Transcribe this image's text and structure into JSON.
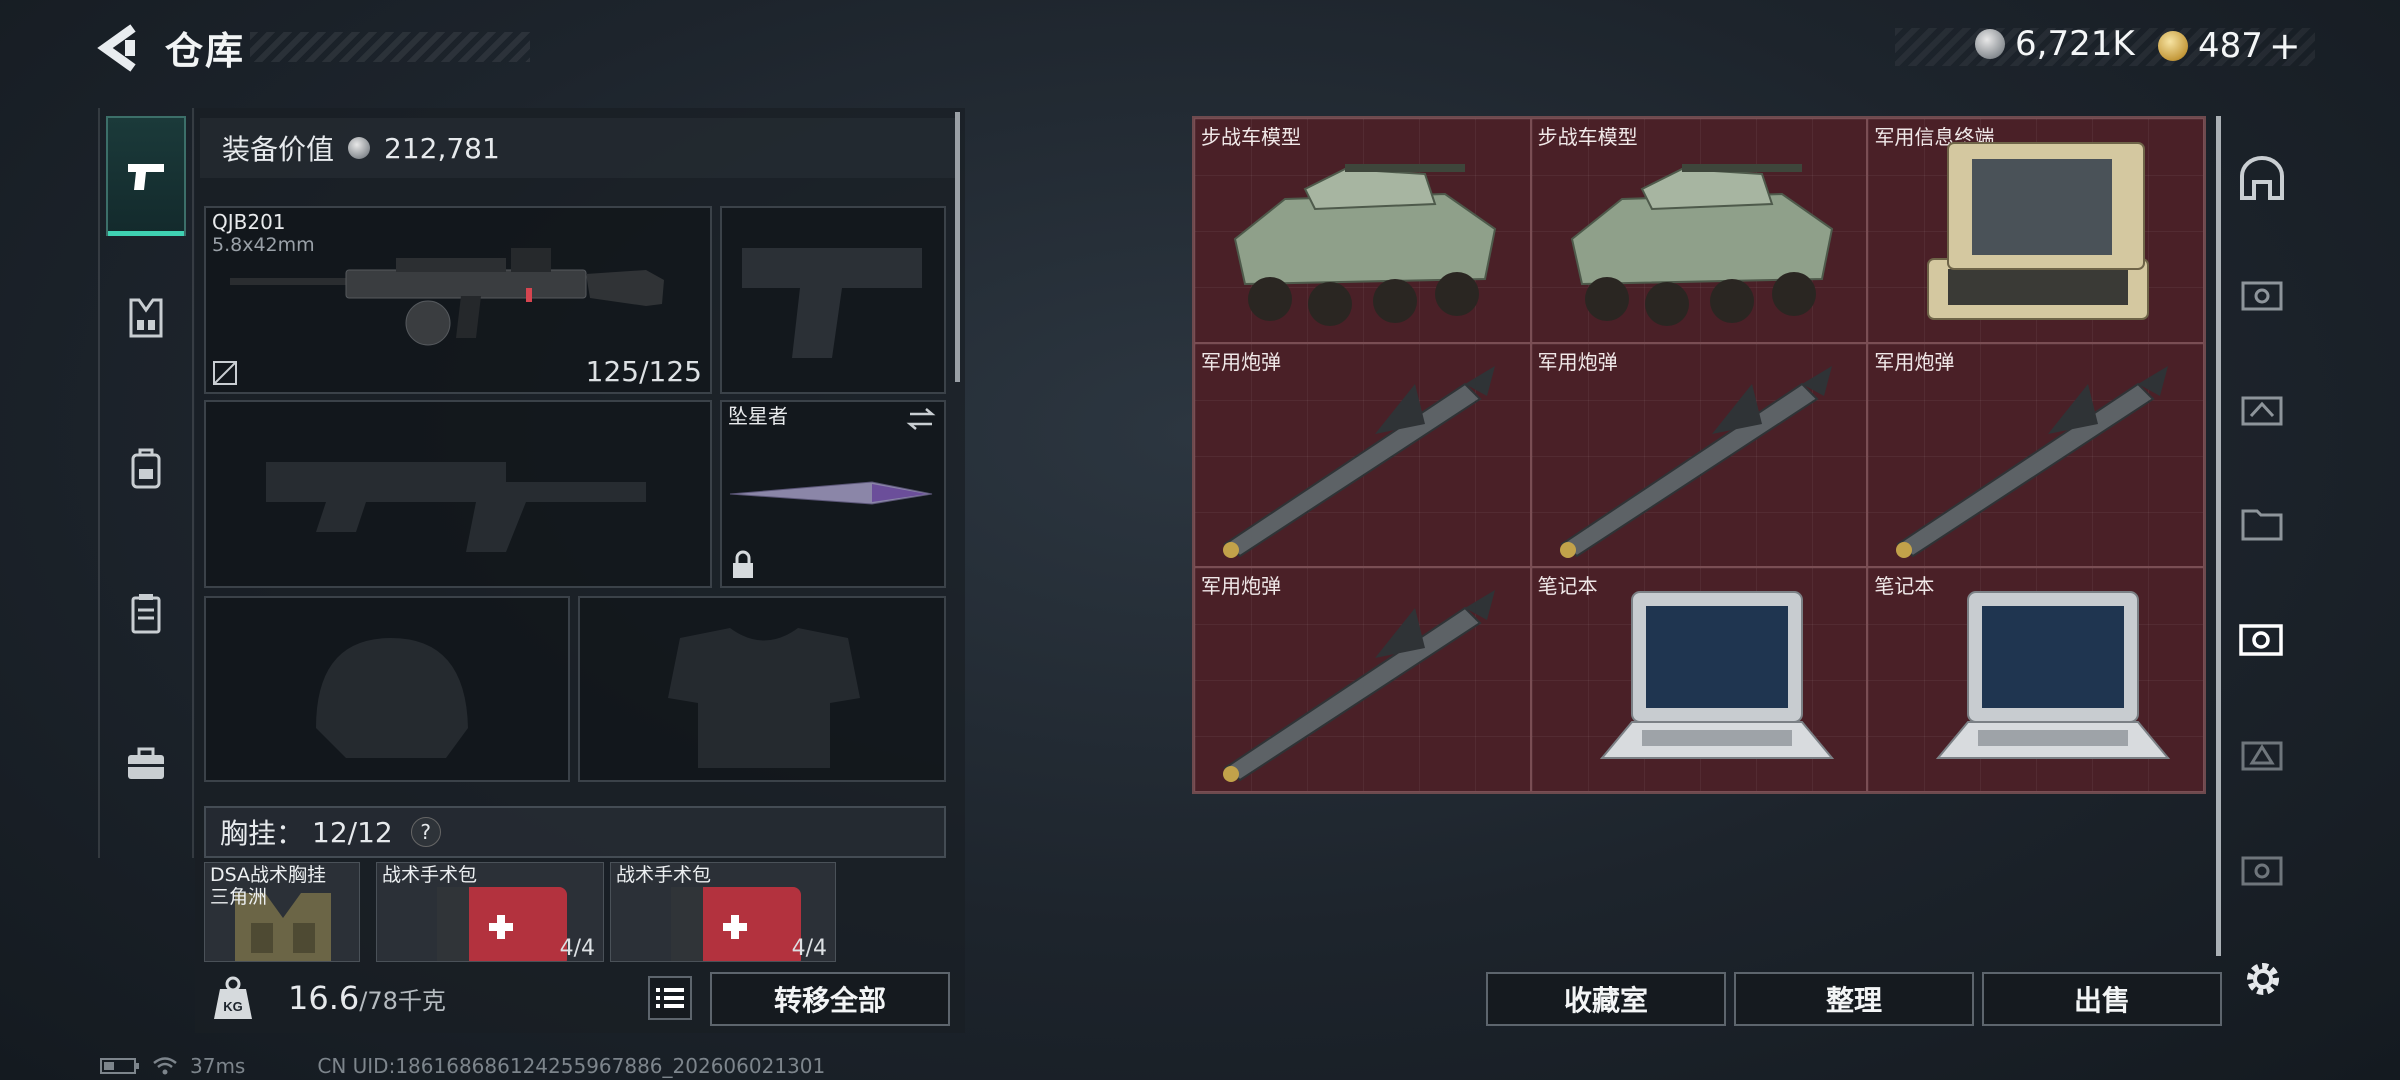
{
  "header": {
    "title": "仓库",
    "currency_silver": "6,721K",
    "currency_gold": "487",
    "gold_add": "+"
  },
  "loadout": {
    "value_label": "装备价值",
    "value": "212,781",
    "primary": {
      "name": "QJB201",
      "caliber": "5.8x42mm",
      "ammo": "125/125"
    },
    "melee": {
      "name": "坠星者"
    },
    "vest": {
      "label": "胸挂：",
      "count": "12/12",
      "help": "?"
    },
    "vest_items": [
      {
        "name": "DSA战术胸挂",
        "sub": "三角洲"
      },
      {
        "name": "战术手术包",
        "uses": "4/4"
      },
      {
        "name": "战术手术包",
        "uses": "4/4"
      }
    ],
    "weight_current": "16.6",
    "weight_max": "/78千克",
    "transfer_all": "转移全部",
    "weight_icon": "KG"
  },
  "stash": {
    "items": [
      {
        "name": "步战车模型",
        "icon": "ifv-model-icon"
      },
      {
        "name": "步战车模型",
        "icon": "ifv-model-icon"
      },
      {
        "name": "军用信息终端",
        "icon": "military-terminal-icon"
      },
      {
        "name": "军用炮弹",
        "icon": "artillery-shell-icon"
      },
      {
        "name": "军用炮弹",
        "icon": "artillery-shell-icon"
      },
      {
        "name": "军用炮弹",
        "icon": "artillery-shell-icon"
      },
      {
        "name": "军用炮弹",
        "icon": "artillery-shell-icon"
      },
      {
        "name": "笔记本",
        "icon": "laptop-icon"
      },
      {
        "name": "笔记本",
        "icon": "laptop-icon"
      }
    ],
    "buttons": {
      "collection": "收藏室",
      "sort": "整理",
      "sell": "出售"
    }
  },
  "status_bar": {
    "ping": "37ms",
    "uid": "CN UID:1861686861242559678​86_202606021301"
  },
  "colors": {
    "accent": "#3fd1b2",
    "stash_cell": "#4a2027"
  }
}
